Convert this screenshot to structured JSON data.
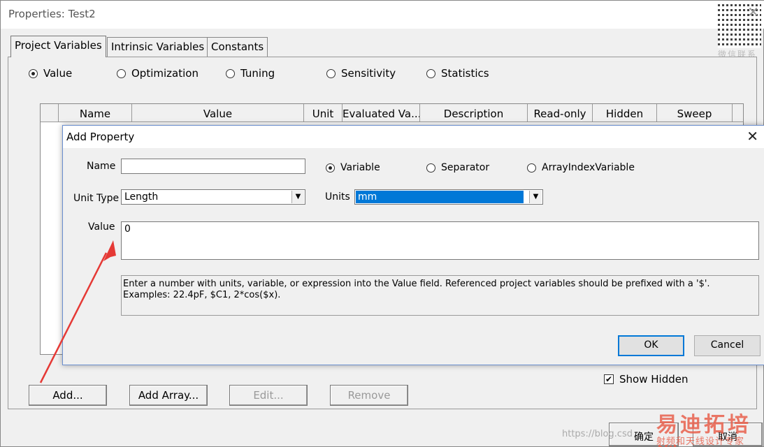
{
  "window": {
    "title": "Properties: Test2",
    "close_glyph": "✕",
    "qr_label": "微信联系"
  },
  "tabs": [
    {
      "label": "Project Variables"
    },
    {
      "label": "Intrinsic Variables"
    },
    {
      "label": "Constants"
    }
  ],
  "mode_radios": [
    {
      "label": "Value",
      "checked": true
    },
    {
      "label": "Optimization",
      "checked": false
    },
    {
      "label": "Tuning",
      "checked": false
    },
    {
      "label": "Sensitivity",
      "checked": false
    },
    {
      "label": "Statistics",
      "checked": false
    }
  ],
  "grid": {
    "columns": [
      "",
      "Name",
      "Value",
      "Unit",
      "Evaluated Va...",
      "Description",
      "Read-only",
      "Hidden",
      "Sweep"
    ]
  },
  "buttons": {
    "add": "Add...",
    "add_array": "Add Array...",
    "edit": "Edit...",
    "remove": "Remove"
  },
  "show_hidden": {
    "label": "Show Hidden",
    "checked": true
  },
  "footer": {
    "ok_cn": "确定",
    "cancel_cn": "取消",
    "blog": "https://blog.csd",
    "logo": "易迪拓培训",
    "logo_sub": "射频和天线设计专家"
  },
  "dialog": {
    "title": "Add Property",
    "close_glyph": "✕",
    "name_label": "Name",
    "name_value": "",
    "kind_radios": [
      {
        "label": "Variable",
        "checked": true
      },
      {
        "label": "Separator",
        "checked": false
      },
      {
        "label": "ArrayIndexVariable",
        "checked": false
      }
    ],
    "unit_type_label": "Unit Type",
    "unit_type_value": "Length",
    "units_label": "Units",
    "units_value": "mm",
    "value_label": "Value",
    "value_text": "0",
    "hint": "Enter a number with units, variable, or expression into the Value field. Referenced project variables should be prefixed with a '$'. Examples: 22.4pF, $C1, 2*cos($x).",
    "ok": "OK",
    "cancel": "Cancel"
  },
  "annotation": {
    "color": "#e53935"
  }
}
